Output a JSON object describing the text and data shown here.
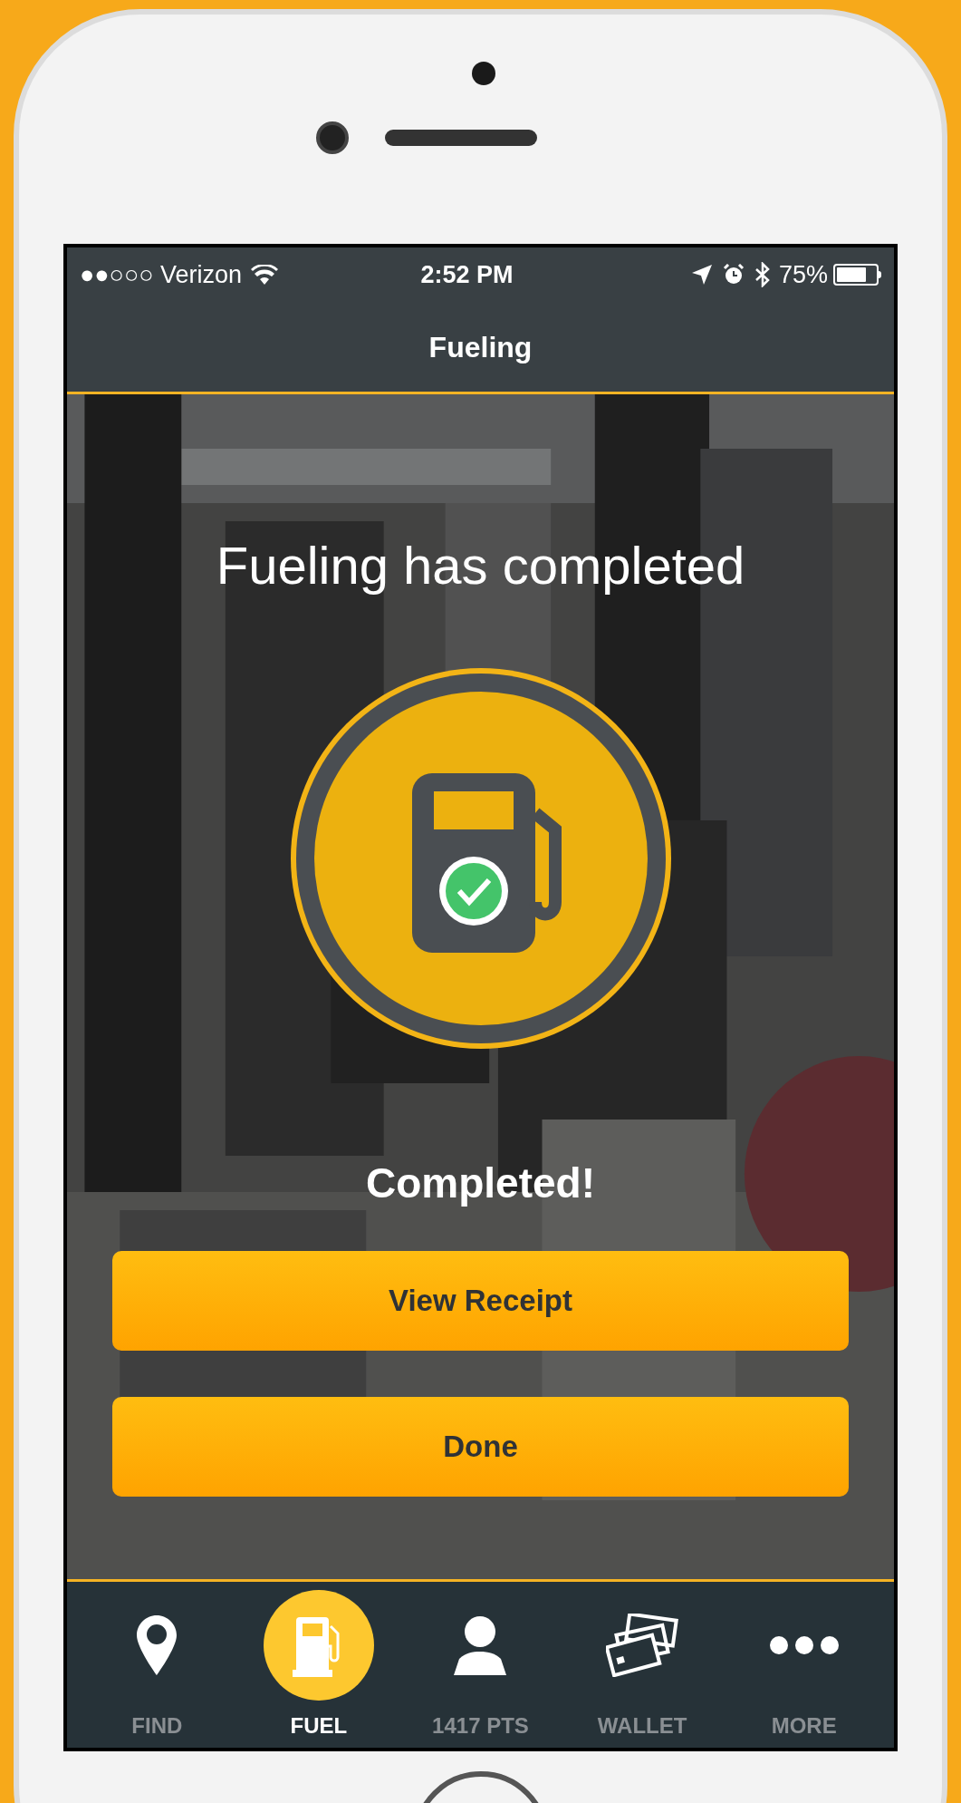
{
  "status_bar": {
    "carrier": "●●○○○ Verizon",
    "time": "2:52 PM",
    "battery": "75%",
    "battery_icon": {
      "level": 0.75
    }
  },
  "nav_bar": {
    "title": "Fueling"
  },
  "heading": "Fueling has completed",
  "status": "Completed!",
  "buttons": [
    "View Receipt",
    "Done"
  ],
  "tabs": [
    {
      "label": "FIND",
      "kind": "pin",
      "selected": false
    },
    {
      "label": "FUEL",
      "kind": "pump",
      "selected": true
    },
    {
      "label": "1417 PTS",
      "kind": "person",
      "selected": false
    },
    {
      "label": "WALLET",
      "kind": "cards",
      "selected": false
    },
    {
      "label": "MORE",
      "kind": "dots",
      "selected": false
    }
  ]
}
